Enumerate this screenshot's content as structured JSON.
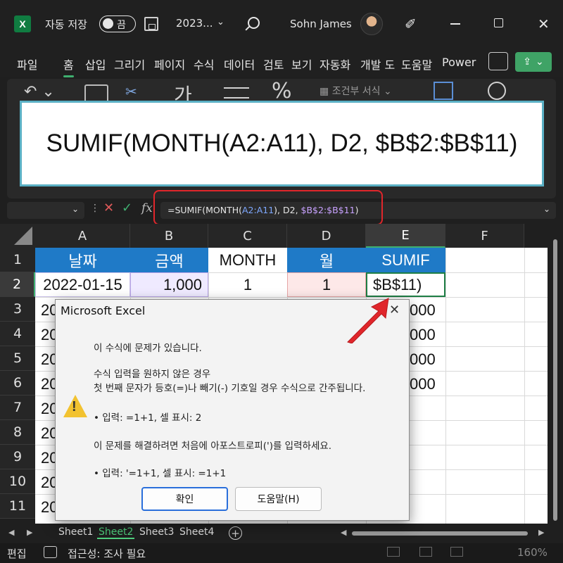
{
  "titlebar": {
    "autosave_label": "자동 저장",
    "autosave_state": "끔",
    "filename": "2023...",
    "username": "Sohn James"
  },
  "ribbon_tabs": [
    "파일",
    "홈",
    "삽입",
    "그리기",
    "페이지",
    "수식",
    "데이터",
    "검토",
    "보기",
    "자동화",
    "개발 도",
    "도움말",
    "Power"
  ],
  "ribbon": {
    "font_glyph": "가",
    "percent_glyph": "%",
    "conditional_format": "조건부 서식"
  },
  "banner": {
    "text": "SUMIF(MONTH(A2:A11), D2, $B$2:$B$11)"
  },
  "formula_bar": {
    "fx": "fx",
    "part1": "=SUMIF(MONTH(",
    "part2": "A2:A11",
    "part3": "), D2, ",
    "part4": "$B$2:$B$11",
    "part5": ")"
  },
  "columns": [
    "A",
    "B",
    "C",
    "D",
    "E",
    "F"
  ],
  "rows": [
    "1",
    "2",
    "3",
    "4",
    "5",
    "6",
    "7",
    "8",
    "9",
    "10",
    "11"
  ],
  "cells": {
    "A1": "날짜",
    "B1": "금액",
    "C1": "MONTH",
    "D1": "월",
    "E1": "SUMIF",
    "A2": "2022-01-15",
    "B2": "1,000",
    "C2": "1",
    "D2": "1",
    "E2": "$B$11)",
    "A_partial": "20",
    "E_partial": "000"
  },
  "dialog": {
    "title": "Microsoft Excel",
    "line1": "이 수식에 문제가 있습니다.",
    "line2": "수식 입력을 원하지 않은 경우",
    "line3": "첫 번째 문자가 등호(=)나 빼기(-) 기호일 경우 수식으로 간주됩니다.",
    "line4": "• 입력:    =1+1, 셀 표시:    2",
    "line5": "이 문제를 해결하려면 처음에 아포스트로피(')를 입력하세요.",
    "line6": "• 입력:    '=1+1, 셀 표시:    =1+1",
    "ok_label": "확인",
    "help_label": "도움말(H)"
  },
  "sheets": [
    "Sheet1",
    "Sheet2",
    "Sheet3",
    "Sheet4"
  ],
  "active_sheet": "Sheet2",
  "statusbar": {
    "mode": "편집",
    "accessibility": "접근성: 조사 필요",
    "zoom": "160%"
  },
  "colors": {
    "header_blue": "#1f7ac7",
    "accent_green": "#3fb070",
    "highlight_red": "#e0262b"
  }
}
